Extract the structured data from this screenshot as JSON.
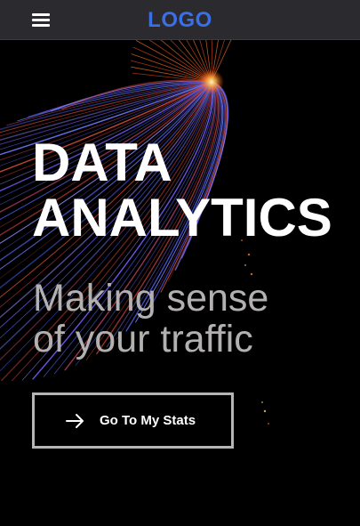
{
  "header": {
    "menu_icon": "hamburger-menu-icon",
    "logo_text": "LOGO",
    "logo_color": "#3b6fe8",
    "background_color": "#2b2a2f"
  },
  "hero": {
    "title_lines": [
      "DATA",
      "ANALYTICS"
    ],
    "subtitle_lines": [
      "Making sense",
      "of your traffic"
    ],
    "subtitle_color": "#b3b0b0",
    "background_image": "light-trails-fireworks",
    "cta": {
      "label": "Go To My Stats",
      "icon": "arrow-right-icon",
      "border_color": "#b5b5b5"
    }
  }
}
